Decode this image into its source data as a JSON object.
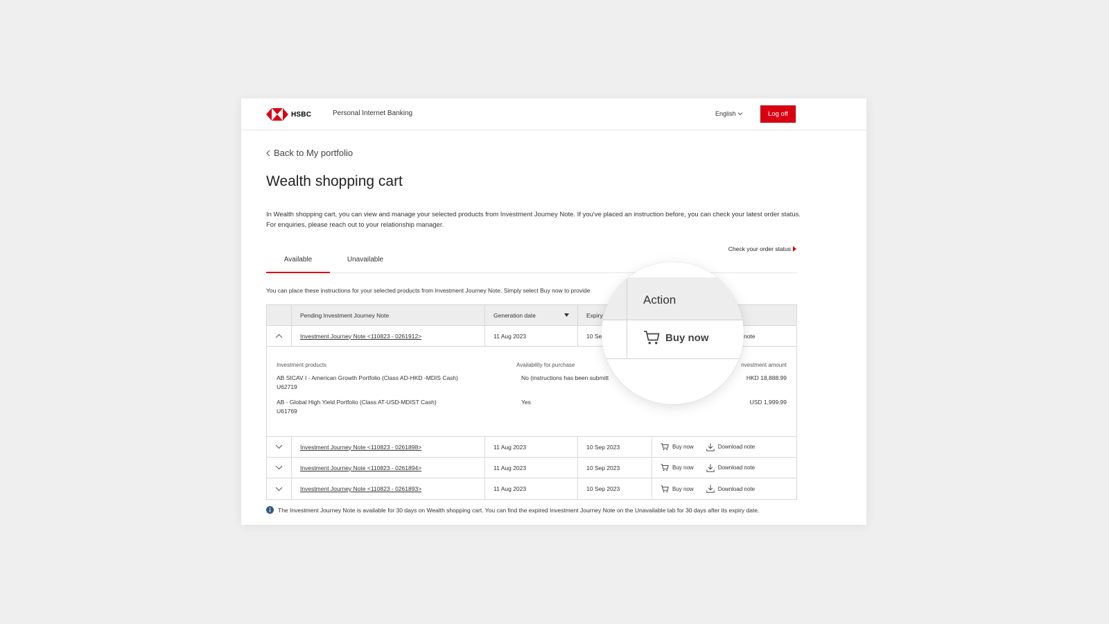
{
  "header": {
    "brand": "HSBC",
    "app_name": "Personal Internet Banking",
    "language": "English",
    "logoff_label": "Log off"
  },
  "nav": {
    "back_label": "Back to My portfolio"
  },
  "page": {
    "title": "Wealth shopping cart",
    "intro": "In Wealth shopping cart, you can view and manage your selected products from Investment Journey Note. If you've placed an instruction before, you can check your latest order status. For enquiries, please reach out to your relationship manager.",
    "check_status_label": "Check your order status"
  },
  "tabs": [
    {
      "label": "Available",
      "active": true
    },
    {
      "label": "Unavailable",
      "active": false
    }
  ],
  "instruction": "You can place these instructions for your selected products from Investment Journey Note. Simply select Buy now to provide",
  "table": {
    "headers": {
      "note": "Pending Investment Journey Note",
      "generation": "Generation date",
      "expiry": "Expiry"
    },
    "expanded_row": {
      "note": "Investment Journey Note <110823 - 0261912>",
      "generation": "11 Aug 2023",
      "expiry": "10 Sep",
      "action_fragment": "note",
      "headers": {
        "products": "Investment products",
        "availability": "Availability for purchase",
        "amount": "nvestment amount"
      },
      "products": [
        {
          "name": "AB SICAV I - American Growth Portfolio (Class AD-HKD -MDIS Cash)",
          "code": "U62719",
          "availability": "No (instructions has been submitt",
          "amount": "HKD 18,888.99"
        },
        {
          "name": "AB - Global High Yield Portfolio (Class AT-USD-MDIST Cash)",
          "code": "U61769",
          "availability": "Yes",
          "amount": "USD 1,999.99"
        }
      ]
    },
    "rows": [
      {
        "note": "Investment Journey Note <110823 - 0261898>",
        "generation": "11 Aug 2023",
        "expiry": "10 Sep 2023"
      },
      {
        "note": "Investment Journey Note <110823 - 0261894>",
        "generation": "11 Aug 2023",
        "expiry": "10 Sep 2023"
      },
      {
        "note": "Investment Journey Note <110823 - 0261893>",
        "generation": "11 Aug 2023",
        "expiry": "10 Sep 2023"
      }
    ],
    "buy_label": "Buy now",
    "download_label": "Download note"
  },
  "footnote": "The Investment Journey Note is available for 30 days on Wealth shopping cart. You can find the expired Investment Journey Note on the Unavailable tab for 30 days after its expiry date.",
  "magnifier": {
    "action_header": "Action",
    "buy_label": "Buy now"
  },
  "colors": {
    "brand_red": "#db0011",
    "background": "#efefef",
    "header_row": "#ededed",
    "info_icon": "#305a85"
  }
}
